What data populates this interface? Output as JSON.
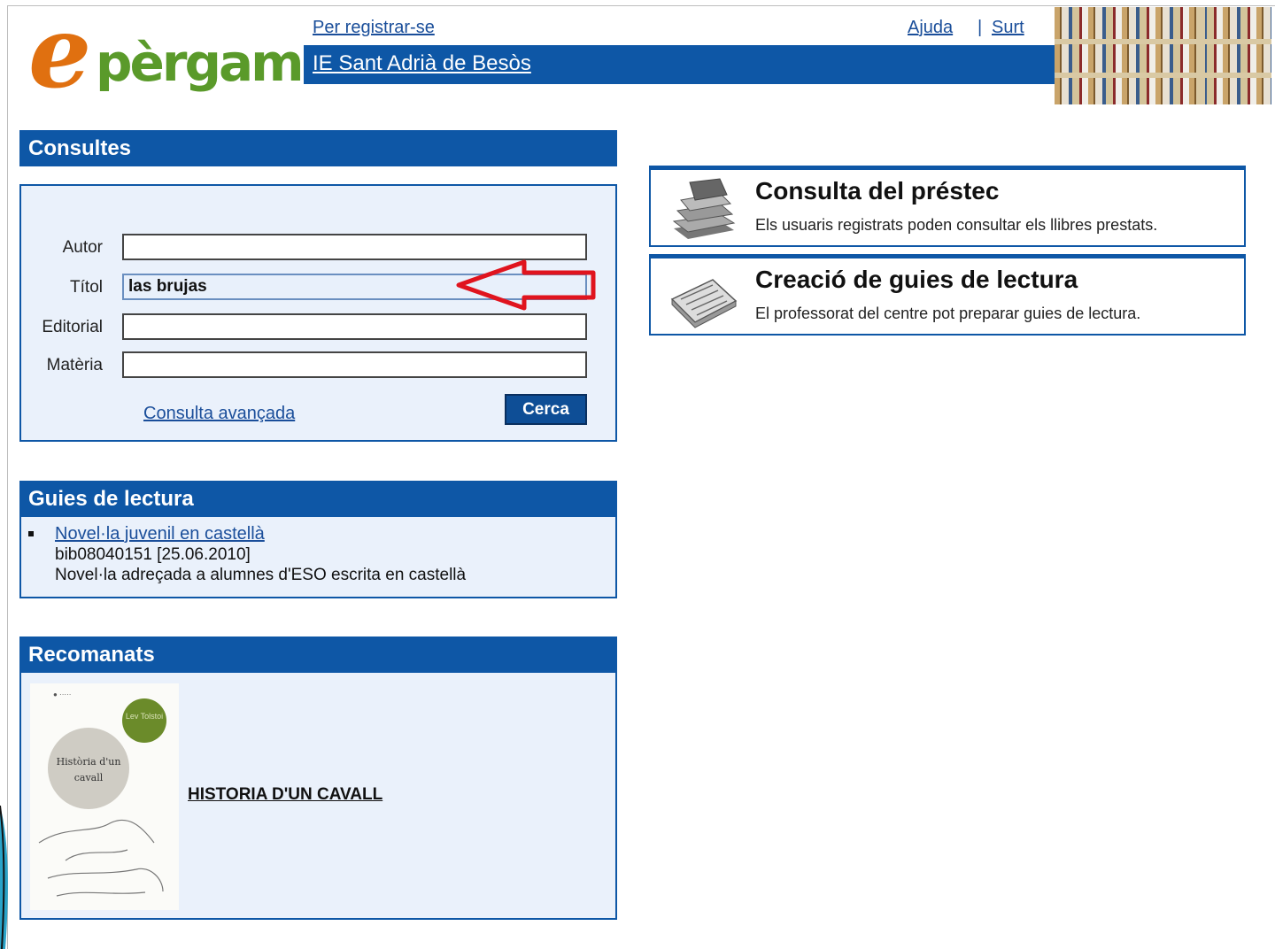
{
  "header": {
    "logo_text": "epèrgam",
    "register_link": "Per registrar-se",
    "help_link": "Ajuda",
    "separator": "|",
    "exit_link": "Surt",
    "library_name": "IE Sant Adrià de Besòs"
  },
  "search_panel": {
    "title": "Consultes",
    "fields": [
      {
        "label": "Autor",
        "value": ""
      },
      {
        "label": "Títol",
        "value": "las brujas"
      },
      {
        "label": "Editorial",
        "value": ""
      },
      {
        "label": "Matèria",
        "value": ""
      }
    ],
    "advanced_link": "Consulta avançada",
    "search_button": "Cerca"
  },
  "guides_panel": {
    "title": "Guies de lectura",
    "items": [
      {
        "link": "Novel·la juvenil en castellà",
        "meta": "bib08040151 [25.06.2010]",
        "description": "Novel·la adreçada a alumnes d'ESO escrita en castellà"
      }
    ]
  },
  "recommended_panel": {
    "title": "Recomanats",
    "items": [
      {
        "title": "HISTORIA D'UN CAVALL",
        "cover_title": "Història d'un cavall",
        "cover_author": "Lev Tolstoi"
      }
    ]
  },
  "cards": [
    {
      "title": "Consulta del préstec",
      "description": "Els usuaris registrats poden consultar els llibres prestats.",
      "icon": "books-stack-icon"
    },
    {
      "title": "Creació de guies de lectura",
      "description": "El professorat del centre pot preparar guies de lectura.",
      "icon": "open-book-icon"
    }
  ],
  "colors": {
    "brand_blue": "#0e57a6",
    "link_blue": "#1a4e9a",
    "logo_orange": "#e07010",
    "logo_green": "#5a9a2a",
    "annotation_red": "#e0141e"
  }
}
